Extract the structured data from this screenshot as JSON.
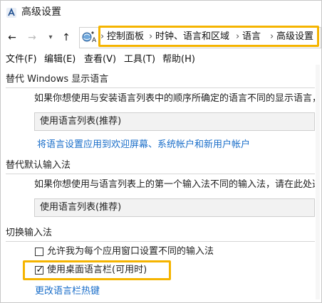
{
  "window": {
    "title": "高级设置"
  },
  "breadcrumb": [
    "控制面板",
    "时钟、语言和区域",
    "语言",
    "高级设置"
  ],
  "menu": [
    "文件(F)",
    "编辑(E)",
    "查看(V)",
    "工具(T)",
    "帮助(H)"
  ],
  "display_language": {
    "title": "替代 Windows 显示语言",
    "description": "如果你想使用与安装语言列表中的顺序所确定的语言不同的显示语言，请在此处选择。",
    "selected": "使用语言列表(推荐)",
    "link": "将语言设置应用到欢迎屏幕、系统帐户和新用户帐户"
  },
  "input_method": {
    "title": "替代默认输入法",
    "description": "如果你想使用与语言列表上的第一个输入法不同的输入法，请在此处选择。",
    "selected": "使用语言列表(推荐)"
  },
  "switch_input": {
    "title": "切换输入法",
    "checkbox_per_app": {
      "label": "允许我为每个应用窗口设置不同的输入法",
      "checked": false
    },
    "checkbox_langbar": {
      "label": "使用桌面语言栏(可用时)",
      "checked": true
    },
    "link": "更改语言栏热键"
  },
  "colors": {
    "highlight": "#f5b400",
    "link": "#1a6ec9"
  },
  "icons": {
    "app": "language-settings-icon",
    "back": "arrow-left-icon",
    "forward": "arrow-right-icon",
    "recent": "chevron-down-icon",
    "up": "arrow-up-icon",
    "address": "control-panel-icon"
  }
}
